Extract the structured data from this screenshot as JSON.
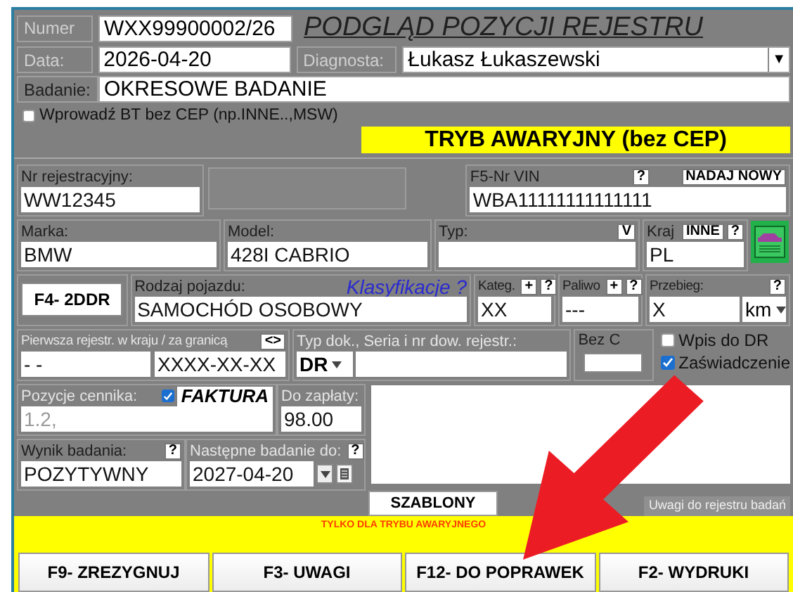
{
  "header": {
    "number_label": "Numer",
    "number": "WXX99900002/26",
    "title": "PODGLĄD POZYCJI REJESTRU",
    "date_label": "Data:",
    "date": "2026-04-20",
    "inspector_label": "Diagnosta:",
    "inspector": "Łukasz Łukaszewski",
    "inspector_dropdown": "▼",
    "exam_label": "Badanie:",
    "exam": "OKRESOWE BADANIE"
  },
  "bt_checkbox": {
    "label": "Wprowadź BT bez CEP (np.INNE..,MSW)",
    "checked": false
  },
  "mode_banner": "TRYB AWARYJNY (bez CEP)",
  "registration": {
    "label": "Nr rejestracyjny:",
    "value": "WW12345",
    "disabled": false
  },
  "vin": {
    "label": "F5-Nr VIN",
    "buttons": [
      "?"
    ],
    "action": "NADAJ  NOWY",
    "value": "WBA11111111111111",
    "disabled": false
  },
  "make": {
    "label": "Marka:",
    "value": "BMW",
    "disabled": false
  },
  "model": {
    "label": "Model:",
    "value": "428I CABRIO",
    "disabled": false
  },
  "type": {
    "label": "Typ:",
    "buttons": [
      "V"
    ],
    "disabled": false
  },
  "country": {
    "label": "Kraj",
    "buttons": [
      "INNE",
      "?"
    ],
    "value": "PL",
    "disabled": false
  },
  "f4_button": "F4- 2DDR",
  "vehicle_kind": {
    "label": "Rodzaj pojazdu:",
    "link": "Klasyfikacje ?",
    "value": "SAMOCHÓD OSOBOWY",
    "disabled": false
  },
  "category": {
    "label": "Kateg.",
    "buttons": [
      "+",
      "?"
    ],
    "value": "XX",
    "disabled": false
  },
  "fuel": {
    "label": "Paliwo",
    "buttons": [
      "+",
      "?"
    ],
    "value": "---",
    "disabled": false
  },
  "mileage": {
    "label": "Przebieg:",
    "buttons": [
      "?"
    ],
    "value": "X",
    "unit": "km",
    "disabled": false
  },
  "first_registration": {
    "label": "Pierwsza rejestr. w kraju / za granicą",
    "buttons": [
      "<>"
    ],
    "domestic": "- -",
    "abroad": "XXXX-XX-XX",
    "disabled": true
  },
  "document": {
    "label": "Typ dok., Seria i nr dow. rejestr.:",
    "doc_type": "DR",
    "disabled": true
  },
  "no_cep": {
    "label": "Bez C"
  },
  "checks": [
    {
      "label": "Wpis do DR",
      "checked": false
    },
    {
      "label": "Zaświadczenie",
      "checked": true
    }
  ],
  "price": {
    "label": "Pozycje cennika:",
    "value": "1.2,",
    "disabled": true,
    "invoice": {
      "label": "FAKTURA",
      "checked": true
    }
  },
  "to_pay": {
    "label": "Do zapłaty:",
    "value": "98.00",
    "disabled": true
  },
  "result": {
    "label": "Wynik badania:",
    "buttons": [
      "?"
    ],
    "value": "POZYTYWNY",
    "disabled": false
  },
  "next_exam": {
    "label": "Następne badanie do:",
    "buttons": [
      "?"
    ],
    "value": "2027-04-20",
    "disabled": true
  },
  "notes": {
    "tab": "SZABLONY",
    "caption": "Uwagi do rejestru badań"
  },
  "footer": {
    "notice": "TYLKO DLA TRYBU AWARYJNEGO",
    "buttons": [
      "F9- ZREZYGNUJ",
      "F3- UWAGI",
      "F12- DO POPRAWEK",
      "F2- WYDRUKI"
    ]
  }
}
